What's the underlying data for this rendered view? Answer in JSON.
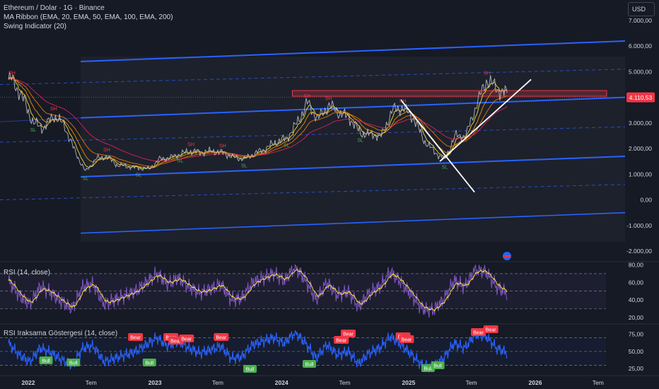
{
  "header": {
    "title": "Ethereum / Dolar · 1G · Binance",
    "indicator_1": "MA Ribbon (EMA, 20, EMA, 50, EMA, 100, EMA, 200)",
    "indicator_2": "Swing Indicator (20)",
    "currency_button": "USD"
  },
  "colors": {
    "background": "#161a25",
    "channel_line": "#2962ff",
    "price_line": "#b2b5be",
    "ema20": "#ffeb3b",
    "ema50": "#ff9800",
    "ema100": "#f57c00",
    "ema200": "#e91e63",
    "resistance_zone": "#f23645",
    "rsi_line": "#7e57c2",
    "rsi_ma": "#ffeb3b",
    "rsi_div_line": "#2962ff",
    "bull": "#4caf50",
    "bear": "#f23645"
  },
  "chart_data": [
    {
      "type": "line",
      "name": "price",
      "title": "Ethereum / Dolar · 1G · Binance",
      "x_labels": [
        "2022",
        "Tem",
        "2023",
        "Tem",
        "2024",
        "Tem",
        "2025",
        "Tem",
        "2026",
        "Tem"
      ],
      "y_ticks": [
        "7.000,00",
        "6.000,00",
        "5.000,00",
        "4.000,00",
        "3.000,00",
        "2.000,00",
        "1.000,00",
        "0,00",
        "-1.000,00",
        "-2.000,00"
      ],
      "ylim": [
        -2000,
        7500
      ],
      "last_price_label": "4.110,53",
      "swing_labels": [
        "SH",
        "SL"
      ],
      "series": [
        {
          "x": [
            "2021-11",
            "2021-12",
            "2022-01",
            "2022-02",
            "2022-03",
            "2022-04",
            "2022-05",
            "2022-06",
            "2022-07",
            "2022-08",
            "2022-09",
            "2022-10",
            "2022-11",
            "2022-12",
            "2023-01",
            "2023-02",
            "2023-03",
            "2023-04",
            "2023-05",
            "2023-06",
            "2023-07",
            "2023-08",
            "2023-09",
            "2023-10",
            "2023-11",
            "2023-12",
            "2024-01",
            "2024-02",
            "2024-03",
            "2024-04",
            "2024-05",
            "2024-06",
            "2024-07",
            "2024-08",
            "2024-09",
            "2024-10",
            "2024-11",
            "2024-12",
            "2025-01",
            "2025-02",
            "2025-03",
            "2025-04",
            "2025-05",
            "2025-06",
            "2025-07",
            "2025-08",
            "2025-09",
            "2025-10"
          ],
          "y": [
            4700,
            4000,
            3000,
            2800,
            3300,
            2900,
            1900,
            1100,
            1600,
            1700,
            1350,
            1300,
            1250,
            1200,
            1600,
            1650,
            1800,
            1900,
            1850,
            1900,
            1850,
            1650,
            1600,
            1800,
            2000,
            2250,
            2400,
            3000,
            3800,
            3150,
            3700,
            3400,
            3200,
            2600,
            2550,
            2500,
            3500,
            3600,
            3200,
            2300,
            1900,
            1550,
            2500,
            2500,
            3700,
            4700,
            4300,
            4110
          ]
        }
      ],
      "resistance_zone": [
        3900,
        4100
      ],
      "channel": {
        "upper": [
          5400,
          6200
        ],
        "middle": [
          3200,
          4000
        ],
        "lower": [
          900,
          1700
        ],
        "bottom": [
          -1300,
          -500
        ]
      }
    },
    {
      "type": "line",
      "title": "RSI (14, close)",
      "y_ticks": [
        "80,00",
        "60,00",
        "40,00",
        "20,00"
      ],
      "ylim": [
        15,
        82
      ],
      "series": [
        {
          "name": "",
          "y": [
            62,
            45,
            35,
            55,
            48,
            38,
            30,
            55,
            58,
            35,
            40,
            45,
            50,
            60,
            70,
            58,
            65,
            55,
            48,
            52,
            58,
            40,
            42,
            60,
            65,
            70,
            62,
            78,
            62,
            40,
            60,
            45,
            50,
            32,
            48,
            55,
            72,
            60,
            45,
            30,
            28,
            40,
            62,
            55,
            75,
            72,
            55,
            48
          ]
        }
      ]
    },
    {
      "type": "line",
      "title": "RSI Iraksama Göstergesi (14, close)",
      "y_ticks": [
        "75,00",
        "50,00",
        "25,00"
      ],
      "ylim": [
        18,
        88
      ],
      "series": [
        {
          "name": "",
          "y": [
            62,
            45,
            35,
            55,
            48,
            38,
            30,
            55,
            58,
            35,
            40,
            45,
            50,
            60,
            70,
            58,
            65,
            55,
            48,
            52,
            58,
            40,
            42,
            60,
            65,
            70,
            62,
            78,
            62,
            40,
            60,
            45,
            50,
            32,
            48,
            55,
            72,
            60,
            45,
            30,
            28,
            40,
            62,
            55,
            75,
            72,
            55,
            48
          ]
        }
      ],
      "signal_labels": {
        "bull": [
          "Bull",
          "Bull",
          "Bull",
          "Bull",
          "Bull",
          "Bull",
          "Bull"
        ],
        "bear": [
          "Bear",
          "Bear",
          "Bear",
          "Bear",
          "Bear",
          "Bear",
          "Bear",
          "Bear",
          "Bear",
          "Bear",
          "Bear"
        ]
      }
    }
  ]
}
